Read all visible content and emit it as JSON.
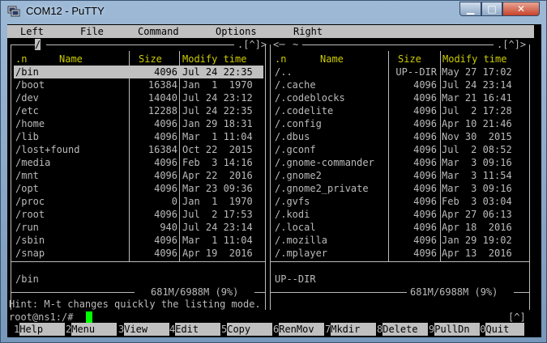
{
  "window": {
    "title": "COM12 - PuTTY"
  },
  "menu": [
    "Left",
    "File",
    "Command",
    "Options",
    "Right"
  ],
  "left_panel": {
    "path": "/",
    "corner": ".[^]>",
    "headers": {
      "n": ".n",
      "name": "Name",
      "size": "Size",
      "modify": "Modify time"
    },
    "rows": [
      {
        "name": "/bin",
        "size": "4096",
        "date": "Jul 24 22:35",
        "selected": true
      },
      {
        "name": "/boot",
        "size": "16384",
        "date": "Jan  1  1970"
      },
      {
        "name": "/dev",
        "size": "14040",
        "date": "Jul 24 23:12"
      },
      {
        "name": "/etc",
        "size": "12288",
        "date": "Jul 24 22:35"
      },
      {
        "name": "/home",
        "size": "4096",
        "date": "Jan 29 18:31"
      },
      {
        "name": "/lib",
        "size": "4096",
        "date": "Mar  1 11:04"
      },
      {
        "name": "/lost+found",
        "size": "16384",
        "date": "Oct 22  2015"
      },
      {
        "name": "/media",
        "size": "4096",
        "date": "Feb  3 14:16"
      },
      {
        "name": "/mnt",
        "size": "4096",
        "date": "Apr 22  2016"
      },
      {
        "name": "/opt",
        "size": "4096",
        "date": "Mar 23 09:36"
      },
      {
        "name": "/proc",
        "size": "0",
        "date": "Jan  1  1970"
      },
      {
        "name": "/root",
        "size": "4096",
        "date": "Jul  2 17:53"
      },
      {
        "name": "/run",
        "size": "940",
        "date": "Jul 24 23:14"
      },
      {
        "name": "/sbin",
        "size": "4096",
        "date": "Mar  1 11:04"
      },
      {
        "name": "/snap",
        "size": "4096",
        "date": "Apr 19  2016"
      }
    ],
    "status": "/bin",
    "disk": "681M/6988M (9%)"
  },
  "right_panel": {
    "path": "~",
    "corner": ".[^]>",
    "headers": {
      "n": ".n",
      "name": "Name",
      "size": "Size",
      "modify": "Modify time"
    },
    "rows": [
      {
        "name": "/..",
        "size": "UP--DIR",
        "date": "May 27 17:02"
      },
      {
        "name": "/.cache",
        "size": "4096",
        "date": "Jul 24 23:14"
      },
      {
        "name": "/.codeblocks",
        "size": "4096",
        "date": "Mar 21 16:41"
      },
      {
        "name": "/.codelite",
        "size": "4096",
        "date": "Jul  2 17:28"
      },
      {
        "name": "/.config",
        "size": "4096",
        "date": "Apr 10 21:46"
      },
      {
        "name": "/.dbus",
        "size": "4096",
        "date": "Nov 30  2015"
      },
      {
        "name": "/.gconf",
        "size": "4096",
        "date": "Jul  2 08:52"
      },
      {
        "name": "/.gnome-commander",
        "size": "4096",
        "date": "Mar  3 09:16"
      },
      {
        "name": "/.gnome2",
        "size": "4096",
        "date": "Mar  3 11:54"
      },
      {
        "name": "/.gnome2_private",
        "size": "4096",
        "date": "Mar  3 09:16"
      },
      {
        "name": "/.gvfs",
        "size": "4096",
        "date": "Feb  3 03:04"
      },
      {
        "name": "/.kodi",
        "size": "4096",
        "date": "Apr 27 06:13"
      },
      {
        "name": "/.local",
        "size": "4096",
        "date": "Apr 18  2016"
      },
      {
        "name": "/.mozilla",
        "size": "4096",
        "date": "Jan 29 19:02"
      },
      {
        "name": "/.mplayer",
        "size": "4096",
        "date": "Apr 13  2016"
      }
    ],
    "status": "UP--DIR",
    "disk": "681M/6988M (9%)"
  },
  "hint": "Hint: M-t changes quickly the listing mode.",
  "prompt": "root@ns1:/#",
  "prompt_corner": "[^]",
  "fkeys": [
    {
      "n": "1",
      "label": "Help"
    },
    {
      "n": "2",
      "label": "Menu"
    },
    {
      "n": "3",
      "label": "View"
    },
    {
      "n": "4",
      "label": "Edit"
    },
    {
      "n": "5",
      "label": "Copy"
    },
    {
      "n": "6",
      "label": "RenMov"
    },
    {
      "n": "7",
      "label": "Mkdir"
    },
    {
      "n": "8",
      "label": "Delete"
    },
    {
      "n": "9",
      "label": "PullDn"
    },
    {
      "n": "10",
      "label": "Quit"
    }
  ],
  "colors": {
    "terminal_bg": "#000000",
    "text": "#bbbbbb",
    "highlight": "#c0c0c0",
    "cursor": "#00ff00"
  }
}
